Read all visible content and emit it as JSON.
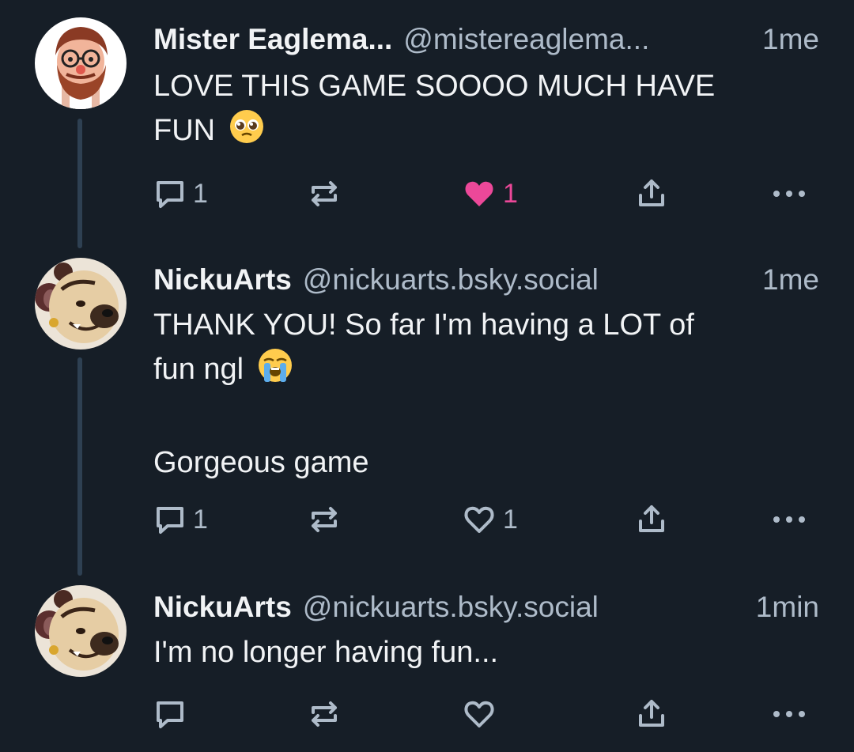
{
  "posts": [
    {
      "display_name": "Mister Eaglema...",
      "handle": "@mistereaglema...",
      "time": "1me",
      "text_line1": "LOVE THIS GAME SOOOO MUCH HAVE",
      "text_line2": "FUN",
      "emoji": "pleading-face",
      "reply_count": "1",
      "like_count": "1",
      "liked": true
    },
    {
      "display_name": "NickuArts",
      "handle": "@nickuarts.bsky.social",
      "time": "1me",
      "text_line1": "THANK YOU! So far I'm having a LOT of",
      "text_line2": "fun ngl",
      "text_para2": "Gorgeous game",
      "emoji": "loudly-crying-face",
      "reply_count": "1",
      "like_count": "1",
      "liked": false
    },
    {
      "display_name": "NickuArts",
      "handle": "@nickuarts.bsky.social",
      "time": "1min",
      "text_line1": "I'm no longer having fun...",
      "reply_count": "",
      "like_count": "",
      "liked": false
    }
  ],
  "colors": {
    "background": "#161e27",
    "thread_line": "#2e4052",
    "muted_text": "#aebbc9",
    "like_pink": "#ec4899"
  },
  "icons": [
    "reply-icon",
    "repost-icon",
    "like-icon",
    "share-icon",
    "more-icon"
  ]
}
